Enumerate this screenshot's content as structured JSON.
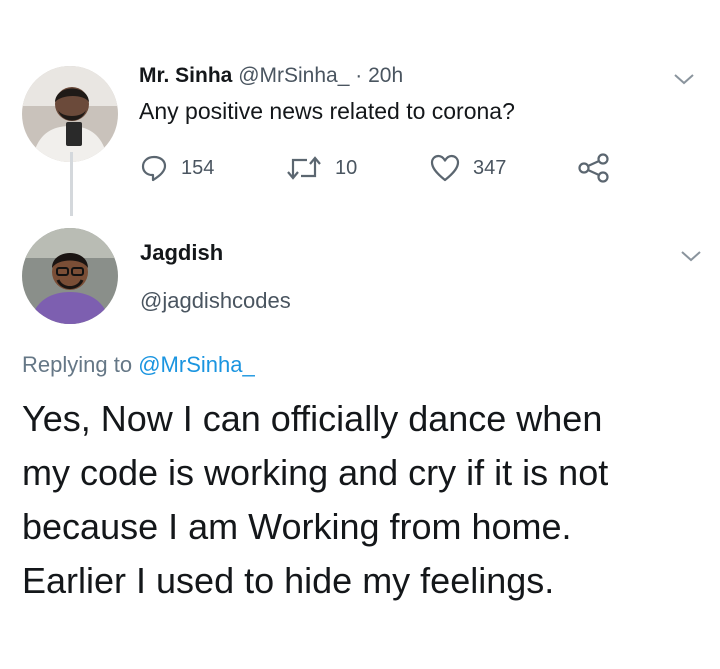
{
  "original_tweet": {
    "author_name": "Mr. Sinha",
    "author_handle": "@MrSinha_",
    "separator": "·",
    "time": "20h",
    "text": "Any positive news related to corona?",
    "actions": {
      "reply_count": "154",
      "retweet_count": "10",
      "like_count": "347"
    },
    "icons": {
      "reply": "reply-icon",
      "retweet": "retweet-icon",
      "like": "heart-icon",
      "share": "share-icon",
      "menu": "chevron-down-icon"
    }
  },
  "reply_tweet": {
    "author_name": "Jagdish",
    "author_handle": "@jagdishcodes",
    "replying_prefix": "Replying to",
    "replying_to": "@MrSinha_",
    "text_lines": [
      "Yes, Now I can officially dance when",
      "my code is working and cry if it is not",
      "because I am Working from home.",
      "Earlier I used to hide my feelings."
    ],
    "icons": {
      "menu": "chevron-down-icon"
    }
  },
  "colors": {
    "text": "#14171a",
    "secondary_text": "#657786",
    "link": "#1b95e0",
    "thread_line": "#d4d8dc",
    "icon": "#5b6670"
  }
}
